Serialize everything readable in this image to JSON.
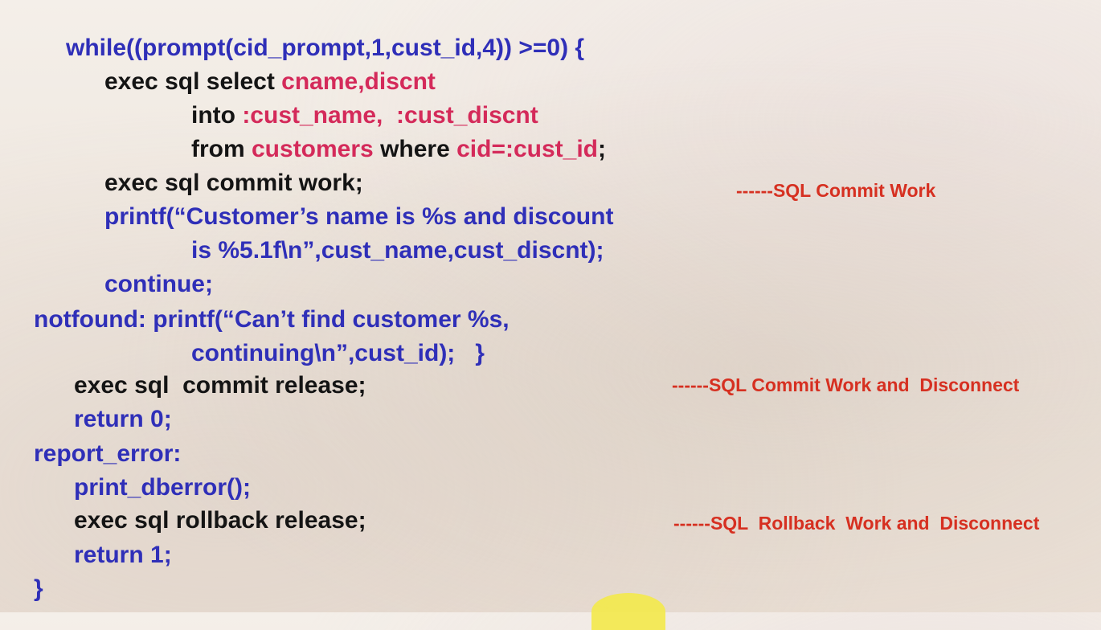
{
  "code": {
    "l1": "while((prompt(cid_prompt,1,cust_id,4)) >=0) {",
    "l2a": "exec sql select ",
    "l2b": "cname,discnt",
    "l3a": "into ",
    "l3b": ":cust_name,  :cust_discnt",
    "l4a": "from ",
    "l4b": "customers",
    "l4c": " where ",
    "l4d": "cid=:cust_id",
    "l4e": ";",
    "l5": "exec sql commit work;",
    "l6": "printf(“Customer’s name is %s and discount",
    "l7": "is %5.1f\\n”,cust_name,cust_discnt);",
    "l8": "continue;",
    "l9": "notfound: printf(“Can’t find customer %s,",
    "l10": "continuing\\n”,cust_id);   }",
    "l11": "exec sql  commit release;",
    "l12": "return 0;",
    "l13": "report_error:",
    "l14": "print_dberror();",
    "l15": "exec sql rollback release;",
    "l16": "return 1;",
    "l17": "}"
  },
  "notes": {
    "n1": "------SQL Commit Work",
    "n2": "------SQL Commit Work and  Disconnect",
    "n3": "------SQL  Rollback  Work and  Disconnect"
  },
  "colors": {
    "keyword_blue": "#2f2fb8",
    "sql_black": "#141414",
    "identifier_red": "#d42a5a",
    "annotation_red": "#d63021",
    "pointer_yellow": "#f3e94a"
  }
}
